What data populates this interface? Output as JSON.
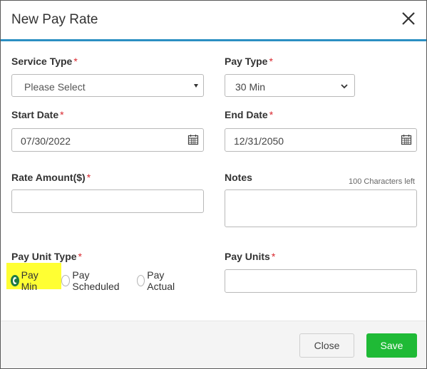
{
  "dialog": {
    "title": "New Pay Rate"
  },
  "form": {
    "service_type": {
      "label": "Service Type",
      "required": "*",
      "value": "Please Select"
    },
    "pay_type": {
      "label": "Pay Type",
      "required": "*",
      "value": "30 Min"
    },
    "start_date": {
      "label": "Start Date",
      "required": "*",
      "value": "07/30/2022"
    },
    "end_date": {
      "label": "End Date",
      "required": "*",
      "value": "12/31/2050"
    },
    "rate_amount": {
      "label": "Rate Amount($)",
      "required": "*",
      "value": ""
    },
    "notes": {
      "label": "Notes",
      "counter": "100 Characters left",
      "value": ""
    },
    "pay_unit_type": {
      "label": "Pay Unit Type",
      "required": "*",
      "options": [
        "Pay Min",
        "Pay Scheduled",
        "Pay Actual"
      ],
      "selected": "Pay Min"
    },
    "pay_units": {
      "label": "Pay Units",
      "required": "*",
      "value": ""
    }
  },
  "footer": {
    "close_label": "Close",
    "save_label": "Save"
  },
  "colors": {
    "header_accent": "#2b8fc2",
    "save_button": "#1fba36",
    "radio_selected": "#1e7b43",
    "required_mark": "#d9272e",
    "highlight": "#ffff33"
  },
  "icons": [
    "close-icon",
    "calendar-icon",
    "chevron-down-icon"
  ]
}
